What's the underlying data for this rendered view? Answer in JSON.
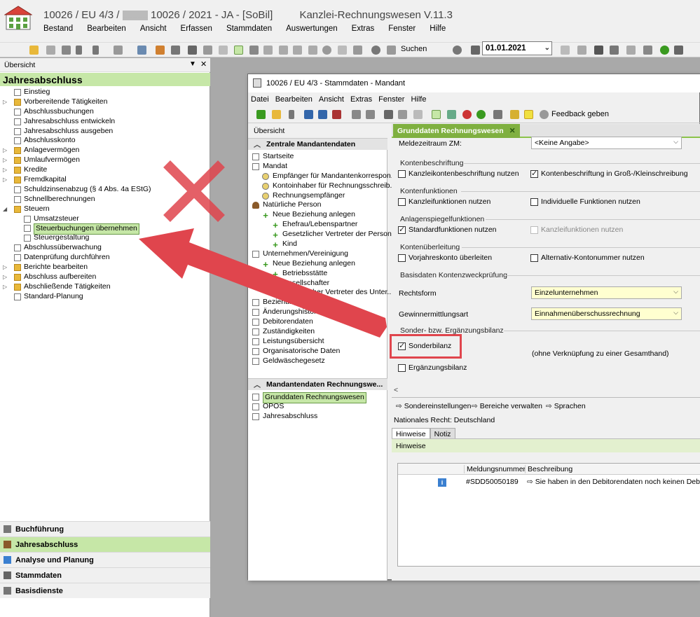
{
  "app": {
    "title_part1": "10026 / EU 4/3 /",
    "title_redacted": "■■■■■",
    "title_part2": "10026 / 2021 - JA - [SoBil]",
    "title_app": "Kanzlei-Rechnungswesen V.11.3",
    "menu": [
      "Bestand",
      "Bearbeiten",
      "Ansicht",
      "Erfassen",
      "Stammdaten",
      "Auswertungen",
      "Extras",
      "Fenster",
      "Hilfe"
    ],
    "search_label": "Suchen",
    "date_value": "01.01.2021"
  },
  "left": {
    "header": "Übersicht",
    "section": "Jahresabschluss",
    "items": [
      {
        "label": "Einstieg",
        "icon": "document-icon",
        "indent": 0,
        "expand": false
      },
      {
        "label": "Vorbereitende Tätigkeiten",
        "icon": "folder-icon",
        "indent": 0,
        "expand": true
      },
      {
        "label": "Abschlussbuchungen",
        "icon": "document-icon",
        "indent": 0,
        "expand": false
      },
      {
        "label": "Jahresabschluss entwickeln",
        "icon": "document-icon",
        "indent": 0,
        "expand": false
      },
      {
        "label": "Jahresabschluss ausgeben",
        "icon": "document-icon",
        "indent": 0,
        "expand": false
      },
      {
        "label": "Abschlusskonto",
        "icon": "document-icon",
        "indent": 0,
        "expand": false
      },
      {
        "label": "Anlagevermögen",
        "icon": "folder-icon",
        "indent": 0,
        "expand": true
      },
      {
        "label": "Umlaufvermögen",
        "icon": "folder-icon",
        "indent": 0,
        "expand": true
      },
      {
        "label": "Kredite",
        "icon": "folder-icon",
        "indent": 0,
        "expand": true
      },
      {
        "label": "Fremdkapital",
        "icon": "folder-icon",
        "indent": 0,
        "expand": true
      },
      {
        "label": "Schuldzinsenabzug (§ 4 Abs. 4a EStG)",
        "icon": "document-icon",
        "indent": 0,
        "expand": false
      },
      {
        "label": "Schnellberechnungen",
        "icon": "document-icon",
        "indent": 0,
        "expand": false
      },
      {
        "label": "Steuern",
        "icon": "folder-icon",
        "indent": 0,
        "expand": true,
        "open": true
      },
      {
        "label": "Umsatzsteuer",
        "icon": "document-icon",
        "indent": 1,
        "expand": false
      },
      {
        "label": "Steuerbuchungen übernehmen",
        "icon": "document-icon",
        "indent": 1,
        "expand": false,
        "selected": true
      },
      {
        "label": "Steuergestaltung",
        "icon": "document-icon",
        "indent": 1,
        "expand": false
      },
      {
        "label": "Abschlussüberwachung",
        "icon": "document-icon",
        "indent": 0,
        "expand": false
      },
      {
        "label": "Datenprüfung durchführen",
        "icon": "document-icon",
        "indent": 0,
        "expand": false
      },
      {
        "label": "Berichte bearbeiten",
        "icon": "folder-icon",
        "indent": 0,
        "expand": true
      },
      {
        "label": "Abschluss aufbereiten",
        "icon": "folder-icon",
        "indent": 0,
        "expand": true
      },
      {
        "label": "Abschließende Tätigkeiten",
        "icon": "folder-icon",
        "indent": 0,
        "expand": true
      },
      {
        "label": "Standard-Planung",
        "icon": "document-icon",
        "indent": 0,
        "expand": false
      }
    ],
    "nav": [
      {
        "label": "Buchführung",
        "active": false
      },
      {
        "label": "Jahresabschluss",
        "active": true
      },
      {
        "label": "Analyse und Planung",
        "active": false
      },
      {
        "label": "Stammdaten",
        "active": false
      },
      {
        "label": "Basisdienste",
        "active": false
      }
    ]
  },
  "inner": {
    "title": "10026 / EU 4/3 - Stammdaten - Mandant",
    "menu": [
      "Datei",
      "Bearbeiten",
      "Ansicht",
      "Extras",
      "Fenster",
      "Hilfe"
    ],
    "feedback": "Feedback geben",
    "nav_header": "Übersicht",
    "section1": "Zentrale Mandantendaten",
    "tree1": [
      {
        "label": "Startseite",
        "icon": "home-icon",
        "indent": 0
      },
      {
        "label": "Mandat",
        "icon": "document-icon",
        "indent": 0
      },
      {
        "label": "Empfänger für Mandantenkorrespon...",
        "icon": "link-icon",
        "indent": 1
      },
      {
        "label": "Kontoinhaber für Rechnungsschreib...",
        "icon": "link-icon",
        "indent": 1
      },
      {
        "label": "Rechnungsempfänger",
        "icon": "link-icon",
        "indent": 1
      },
      {
        "label": "Natürliche Person",
        "icon": "person-icon",
        "indent": 0
      },
      {
        "label": "Neue Beziehung anlegen",
        "icon": "plus-icon",
        "indent": 1
      },
      {
        "label": "Ehefrau/Lebenspartner",
        "icon": "plus-icon",
        "indent": 2
      },
      {
        "label": "Gesetzlicher Vertreter der Person",
        "icon": "plus-icon",
        "indent": 2
      },
      {
        "label": "Kind",
        "icon": "plus-icon",
        "indent": 2
      },
      {
        "label": "Unternehmen/Vereinigung",
        "icon": "building-icon",
        "indent": 0
      },
      {
        "label": "Neue Beziehung anlegen",
        "icon": "plus-icon",
        "indent": 1
      },
      {
        "label": "Betriebsstätte",
        "icon": "plus-icon",
        "indent": 2
      },
      {
        "label": "Gesellschafter",
        "icon": "plus-icon",
        "indent": 2
      },
      {
        "label": "Gesetzlicher Vertreter des Unter...",
        "icon": "plus-icon",
        "indent": 2
      },
      {
        "label": "Beziehungsübersicht",
        "icon": "document-icon",
        "indent": 0
      },
      {
        "label": "Änderungshistorie",
        "icon": "document-icon",
        "indent": 0
      },
      {
        "label": "Debitorendaten",
        "icon": "document-icon",
        "indent": 0
      },
      {
        "label": "Zuständigkeiten",
        "icon": "document-icon",
        "indent": 0
      },
      {
        "label": "Leistungsübersicht",
        "icon": "document-icon",
        "indent": 0
      },
      {
        "label": "Organisatorische Daten",
        "icon": "document-icon",
        "indent": 0
      },
      {
        "label": "Geldwäschegesetz",
        "icon": "document-icon",
        "indent": 0
      }
    ],
    "section2": "Mandantendaten Rechnungswe...",
    "tree2": [
      {
        "label": "Grunddaten Rechnungswesen",
        "icon": "document-icon",
        "selected": true
      },
      {
        "label": "OPOS",
        "icon": "document-icon",
        "selected": false
      },
      {
        "label": "Jahresabschluss",
        "icon": "document-icon",
        "selected": false
      }
    ]
  },
  "content": {
    "tab": "Grunddaten Rechnungswesen",
    "meldezeitraum_label": "Meldezeitraum ZM:",
    "meldezeitraum_value": "<Keine Angabe>",
    "grp_konten": "Kontenbeschriftung",
    "cb_kanzleikonten": "Kanzleikontenbeschriftung nutzen",
    "cb_grossklein": "Kontenbeschriftung in Groß-/Kleinschreibung",
    "grp_funktionen": "Kontenfunktionen",
    "cb_kanzleifkt": "Kanzleifunktionen nutzen",
    "cb_indfkt": "Individuelle Funktionen nutzen",
    "grp_anlagen": "Anlagenspiegelfunktionen",
    "cb_standard": "Standardfunktionen nutzen",
    "cb_kanzleifkt2": "Kanzleifunktionen nutzen",
    "grp_ueberleitung": "Kontenüberleitung",
    "cb_vorjahr": "Vorjahreskonto überleiten",
    "cb_alternativ": "Alternativ-Kontonummer nutzen",
    "grp_basis": "Basisdaten Kontenzweckprüfung",
    "rechtsform_label": "Rechtsform",
    "rechtsform_value": "Einzelunternehmen",
    "gewinn_label": "Gewinnermittlungsart",
    "gewinn_value": "Einnahmenüberschussrechnung",
    "grp_sonder": "Sonder- bzw. Ergänzungsbilanz",
    "cb_sonder": "Sonderbilanz",
    "sonder_note": "(ohne Verknüpfung zu einer Gesamthand)",
    "cb_ergaenzung": "Ergänzungsbilanz",
    "links": [
      "Sondereinstellungen",
      "Bereiche verwalten",
      "Sprachen"
    ],
    "nationales_recht": "Nationales Recht: Deutschland",
    "bottom_tabs": [
      "Hinweise",
      "Notiz"
    ],
    "hinweise_header": "Hinweise",
    "table_headers": [
      "Meldungsnummer",
      "Beschreibung"
    ],
    "table_rows": [
      {
        "nummer": "#SDD50050189",
        "beschreibung": "⇨ Sie haben in den Debitorendaten noch keinen Debitor z"
      }
    ]
  },
  "colors": {
    "accent_green": "#c6e7a7",
    "tab_green": "#7fb040",
    "annotation_red": "#e0454d"
  }
}
